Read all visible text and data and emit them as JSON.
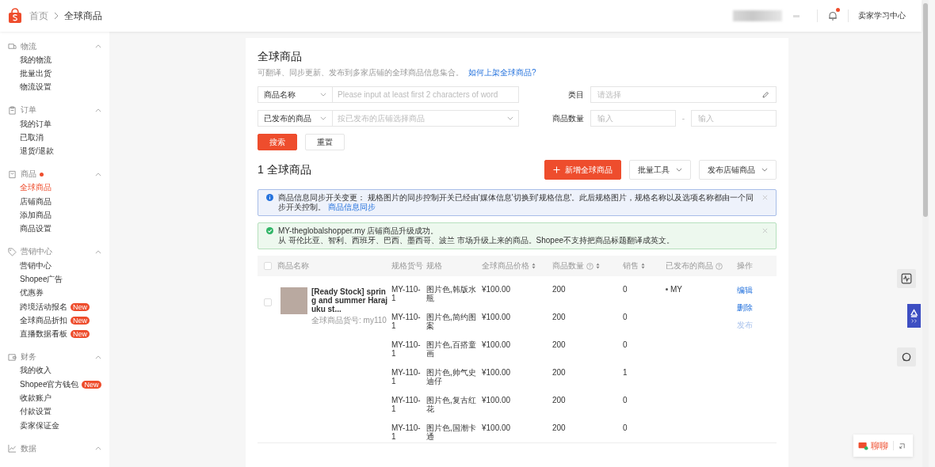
{
  "header": {
    "breadcrumb": [
      {
        "label": "首页"
      },
      {
        "label": "全球商品"
      }
    ],
    "has_notification": true,
    "learning_center": "卖家学习中心"
  },
  "sidebar": [
    {
      "label": "物流",
      "kind": "logistics",
      "expanded": true,
      "dot": false,
      "items": [
        {
          "label": "我的物流",
          "selected": false
        },
        {
          "label": "批量出货",
          "selected": false
        },
        {
          "label": "物流设置",
          "selected": false
        }
      ]
    },
    {
      "label": "订单",
      "kind": "orders",
      "expanded": true,
      "dot": false,
      "items": [
        {
          "label": "我的订单",
          "selected": false
        },
        {
          "label": "已取消",
          "selected": false
        },
        {
          "label": "退货/退款",
          "selected": false
        }
      ]
    },
    {
      "label": "商品",
      "kind": "products",
      "expanded": true,
      "dot": true,
      "items": [
        {
          "label": "全球商品",
          "selected": true
        },
        {
          "label": "店铺商品",
          "selected": false
        },
        {
          "label": "添加商品",
          "selected": false
        },
        {
          "label": "商品设置",
          "selected": false
        }
      ]
    },
    {
      "label": "营销中心",
      "kind": "marketing",
      "expanded": true,
      "dot": false,
      "items": [
        {
          "label": "营销中心",
          "selected": false
        },
        {
          "label": "Shopee广告",
          "selected": false
        },
        {
          "label": "优惠券",
          "selected": false
        },
        {
          "label": "跨境活动报名",
          "selected": false,
          "badge": "New"
        },
        {
          "label": "全球商品折扣",
          "selected": false,
          "badge": "New"
        },
        {
          "label": "直播数据看板",
          "selected": false,
          "badge": "New"
        }
      ]
    },
    {
      "label": "财务",
      "kind": "finance",
      "expanded": true,
      "dot": false,
      "items": [
        {
          "label": "我的收入",
          "selected": false
        },
        {
          "label": "Shopee官方钱包",
          "selected": false,
          "badge": "New"
        },
        {
          "label": "收款账户",
          "selected": false
        },
        {
          "label": "付款设置",
          "selected": false
        },
        {
          "label": "卖家保证金",
          "selected": false
        }
      ]
    },
    {
      "label": "数据",
      "kind": "data",
      "expanded": true,
      "dot": false
    }
  ],
  "card": {
    "title": "全球商品",
    "subtitle": "可翻译、同步更新、发布到多家店铺的全球商品信息集合。",
    "help_link": "如何上架全球商品?",
    "filters": {
      "name_type": "商品名称",
      "name_placeholder": "Please input at least first 2 characters of word",
      "category_label": "类目",
      "category_placeholder": "请选择",
      "published_type": "已发布的商品",
      "shop_placeholder": "按已发布的店铺选择商品",
      "quantity_label": "商品数量",
      "quantity_min_placeholder": "输入",
      "quantity_separator": "-",
      "quantity_max_placeholder": "输入"
    },
    "search_button": "搜索",
    "reset_button": "重置",
    "count_title": "1 全球商品",
    "add_button": "新增全球商品",
    "bulk_button": "批量工具",
    "publish_button": "发布店铺商品",
    "alerts": [
      {
        "kind": "info",
        "text": "商品信息同步开关变更： 规格图片的同步控制开关已经由'媒体信息'切换到'规格信息'。此后规格图片，规格名称以及选项名称都由一个同步开关控制。",
        "link": "商品信息同步"
      },
      {
        "kind": "success",
        "title": "MY-theglobalshopper.my 店铺商品升级成功。",
        "text": "从 哥伦比亚、智利、西班牙、巴西、墨西哥、波兰 市场升级上来的商品。Shopee不支持把商品标题翻译成英文。"
      }
    ],
    "table": {
      "all_checked": false,
      "columns": [
        {
          "label": "商品名称",
          "sortable": false,
          "help": false
        },
        {
          "label": "规格货号",
          "sortable": false,
          "help": false
        },
        {
          "label": "规格",
          "sortable": false,
          "help": false
        },
        {
          "label": "全球商品价格",
          "sortable": true,
          "help": false
        },
        {
          "label": "商品数量",
          "sortable": true,
          "help": true
        },
        {
          "label": "销售",
          "sortable": true,
          "help": false
        },
        {
          "label": "已发布的商品",
          "sortable": false,
          "help": true
        },
        {
          "label": "操作",
          "sortable": false,
          "help": false
        }
      ],
      "products": [
        {
          "checked": false,
          "name": "[Ready Stock] spring and summer Harajuku st...",
          "sku_label": "全球商品货号: my110",
          "published": "MY",
          "actions": [
            {
              "label": "编辑",
              "disabled": false
            },
            {
              "label": "删除",
              "disabled": false
            },
            {
              "label": "发布",
              "disabled": true
            }
          ],
          "variants": [
            {
              "sku": "MY-110-1",
              "spec": "图片色,韩版水瓶",
              "price": "¥100.00",
              "quantity": "200",
              "sales": "0"
            },
            {
              "sku": "MY-110-1",
              "spec": "图片色,简约图案",
              "price": "¥100.00",
              "quantity": "200",
              "sales": "0"
            },
            {
              "sku": "MY-110-1",
              "spec": "图片色,百搭童画",
              "price": "¥100.00",
              "quantity": "200",
              "sales": "0"
            },
            {
              "sku": "MY-110-1",
              "spec": "图片色,帅气史迪仔",
              "price": "¥100.00",
              "quantity": "200",
              "sales": "1"
            },
            {
              "sku": "MY-110-1",
              "spec": "图片色,复古红花",
              "price": "¥100.00",
              "quantity": "200",
              "sales": "0"
            },
            {
              "sku": "MY-110-1",
              "spec": "图片色,国潮卡通",
              "price": "¥100.00",
              "quantity": "200",
              "sales": "0"
            }
          ]
        }
      ]
    }
  },
  "chat": {
    "label": "聊聊"
  }
}
